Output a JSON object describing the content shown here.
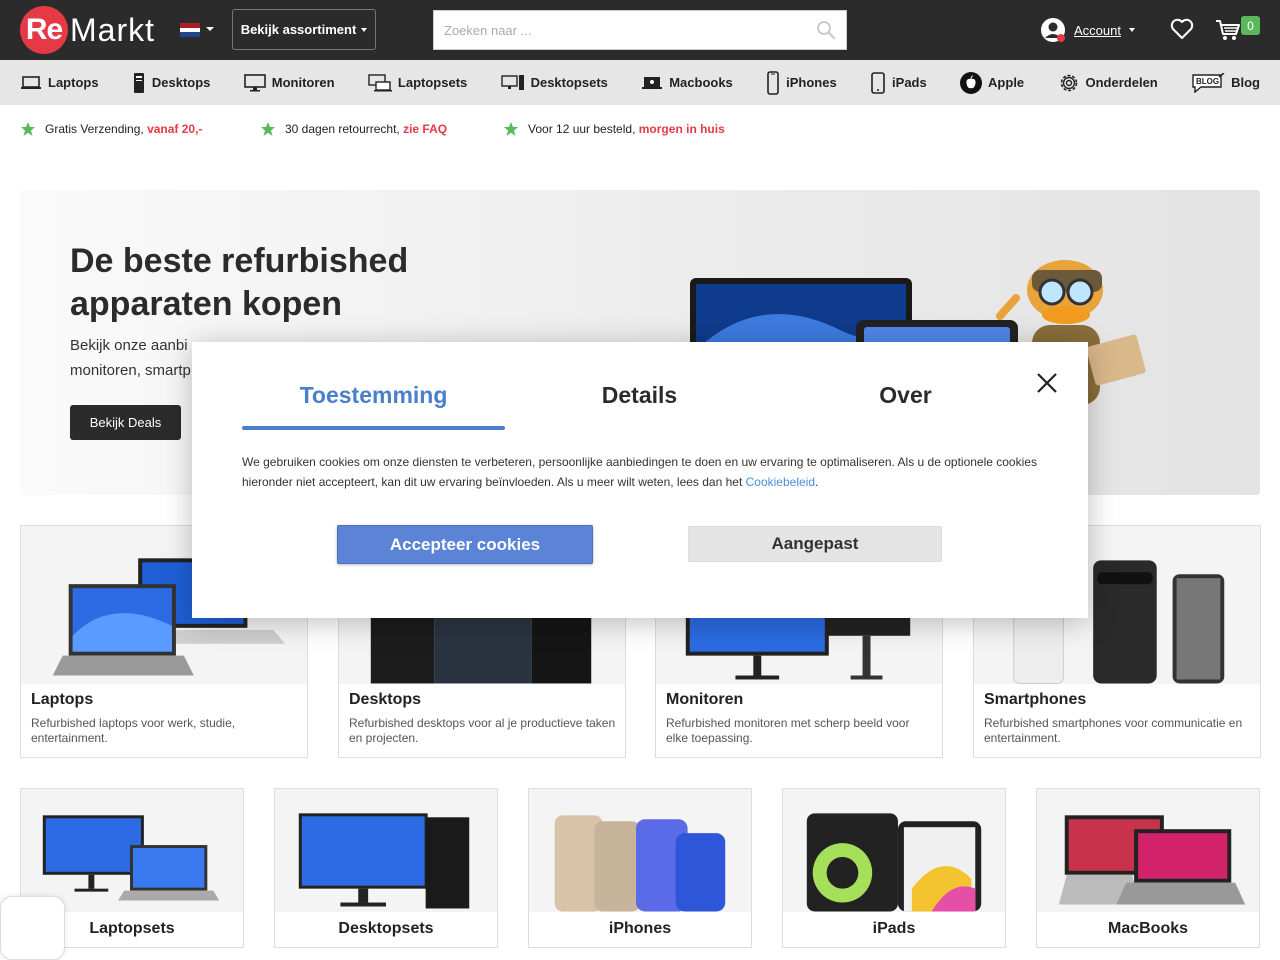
{
  "header": {
    "logo_prefix": "Re",
    "logo_suffix": "Markt",
    "assortment_label": "Bekijk assortiment",
    "search_placeholder": "Zoeken naar ...",
    "account_label": "Account",
    "cart_count": "0"
  },
  "nav": {
    "items": [
      {
        "label": "Laptops",
        "icon": "laptop-icon"
      },
      {
        "label": "Desktops",
        "icon": "desktop-tower-icon"
      },
      {
        "label": "Monitoren",
        "icon": "monitor-icon"
      },
      {
        "label": "Laptopsets",
        "icon": "laptopset-icon"
      },
      {
        "label": "Desktopsets",
        "icon": "desktopset-icon"
      },
      {
        "label": "Macbooks",
        "icon": "macbook-icon"
      },
      {
        "label": "iPhones",
        "icon": "iphone-icon"
      },
      {
        "label": "iPads",
        "icon": "ipad-icon"
      },
      {
        "label": "Apple",
        "icon": "apple-icon"
      },
      {
        "label": "Onderdelen",
        "icon": "gear-icon"
      },
      {
        "label": "Blog",
        "icon": "blog-icon"
      }
    ]
  },
  "usps": [
    {
      "text": "Gratis Verzending,",
      "highlight": "vanaf 20,-"
    },
    {
      "text": "30 dagen retourrecht,",
      "highlight": "zie FAQ"
    },
    {
      "text": "Voor 12 uur besteld,",
      "highlight": "morgen in huis"
    }
  ],
  "hero": {
    "title": "De beste refurbished apparaten kopen",
    "subtitle": "Bekijk onze aanbi",
    "subtitle_line2": "monitoren, smartp",
    "button": "Bekijk Deals"
  },
  "cards": [
    {
      "title": "Laptops",
      "desc": "Refurbished laptops voor werk, studie, entertainment."
    },
    {
      "title": "Desktops",
      "desc": "Refurbished desktops voor al je productieve taken en projecten."
    },
    {
      "title": "Monitoren",
      "desc": "Refurbished monitoren met scherp beeld voor elke toepassing."
    },
    {
      "title": "Smartphones",
      "desc": "Refurbished smartphones voor communicatie en entertainment."
    }
  ],
  "cards2": [
    {
      "title": "Laptopsets"
    },
    {
      "title": "Desktopsets"
    },
    {
      "title": "iPhones"
    },
    {
      "title": "iPads"
    },
    {
      "title": "MacBooks"
    }
  ],
  "cookie_modal": {
    "tabs": [
      "Toestemming",
      "Details",
      "Over"
    ],
    "text": "We gebruiken cookies om onze diensten te verbeteren, persoonlijke aanbiedingen te doen en uw ervaring te optimaliseren. Als u de optionele cookies hieronder niet accepteert, kan dit uw ervaring beïnvloeden. Als u meer wilt weten, lees dan het ",
    "link": "Cookiebeleid",
    "text_end": ".",
    "accept": "Accepteer cookies",
    "custom": "Aangepast"
  },
  "colors": {
    "brand_red": "#e63946",
    "accent_blue": "#4a7fcb",
    "usp_star": "#5cb85c"
  }
}
